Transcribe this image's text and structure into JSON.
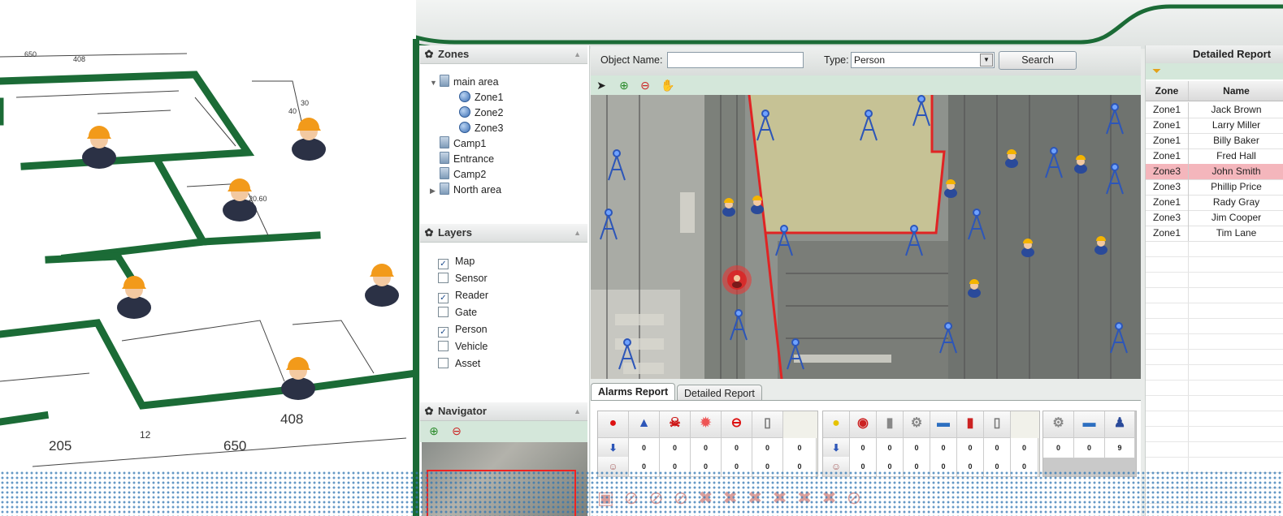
{
  "zones": {
    "title": "Zones",
    "tree": [
      {
        "label": "main area",
        "kind": "folder",
        "expanded": true,
        "level": 0
      },
      {
        "label": "Zone1",
        "kind": "zone",
        "level": 1
      },
      {
        "label": "Zone2",
        "kind": "zone",
        "level": 1
      },
      {
        "label": "Zone3",
        "kind": "zone",
        "level": 1
      },
      {
        "label": "Camp1",
        "kind": "folder",
        "level": 0
      },
      {
        "label": "Entrance",
        "kind": "folder",
        "level": 0
      },
      {
        "label": "Camp2",
        "kind": "folder",
        "level": 0
      },
      {
        "label": "North area",
        "kind": "folder",
        "expanded": false,
        "level": 0
      }
    ]
  },
  "layers": {
    "title": "Layers",
    "items": [
      {
        "label": "Map",
        "checked": true
      },
      {
        "label": "Sensor",
        "checked": false
      },
      {
        "label": "Reader",
        "checked": true
      },
      {
        "label": "Gate",
        "checked": false
      },
      {
        "label": "Person",
        "checked": true
      },
      {
        "label": "Vehicle",
        "checked": false
      },
      {
        "label": "Asset",
        "checked": false
      }
    ]
  },
  "navigator": {
    "title": "Navigator"
  },
  "search": {
    "object_name_label": "Object Name:",
    "object_name_value": "",
    "type_label": "Type:",
    "type_value": "Person",
    "button_label": "Search"
  },
  "blueprint": {
    "dimensions": [
      "650",
      "408",
      "205",
      "12",
      "408",
      "650",
      "20.60",
      "40",
      "30"
    ]
  },
  "tabs": [
    {
      "label": "Alarms Report",
      "active": true
    },
    {
      "label": "Detailed Report",
      "active": false
    }
  ],
  "alarms": {
    "group1": {
      "icons": [
        "alarm-light-icon",
        "reader-tower-icon",
        "danger-skull-icon",
        "fire-icon",
        "stop-icon",
        "door-icon"
      ],
      "row1": [
        "0",
        "0",
        "0",
        "0",
        "0",
        "0"
      ],
      "row2": [
        "0",
        "0",
        "0",
        "0",
        "0",
        "0"
      ]
    },
    "group2": {
      "icons": [
        "yellow-alarm-icon",
        "motion-icon",
        "battery-icon",
        "gear-sensor-icon",
        "vehicle-icon",
        "battery-low-icon",
        "door-open-icon"
      ],
      "row1": [
        "0",
        "0",
        "0",
        "0",
        "0",
        "0",
        "0"
      ],
      "row2": [
        "0",
        "0",
        "0",
        "0",
        "0",
        "0",
        "0"
      ]
    },
    "group3": {
      "icons": [
        "settings-icon",
        "car-icon",
        "person-icon"
      ],
      "row1": [
        "0",
        "0",
        "9"
      ]
    }
  },
  "report": {
    "title": "Detailed Report",
    "columns": [
      "Zone",
      "Name"
    ],
    "rows": [
      {
        "zone": "Zone1",
        "name": "Jack Brown",
        "alarm": false
      },
      {
        "zone": "Zone1",
        "name": "Larry Miller",
        "alarm": false
      },
      {
        "zone": "Zone1",
        "name": "Billy Baker",
        "alarm": false
      },
      {
        "zone": "Zone1",
        "name": "Fred Hall",
        "alarm": false
      },
      {
        "zone": "Zone3",
        "name": "John Smith",
        "alarm": true
      },
      {
        "zone": "Zone3",
        "name": "Phillip Price",
        "alarm": false
      },
      {
        "zone": "Zone1",
        "name": "Rady Gray",
        "alarm": false
      },
      {
        "zone": "Zone3",
        "name": "Jim Cooper",
        "alarm": false
      },
      {
        "zone": "Zone1",
        "name": "Tim Lane",
        "alarm": false
      }
    ]
  },
  "colors": {
    "brand_green": "#1b6b36",
    "alarm_row": "#f4b6bc",
    "zone_border": "#e02424",
    "toolbar": "#d4e7da"
  }
}
